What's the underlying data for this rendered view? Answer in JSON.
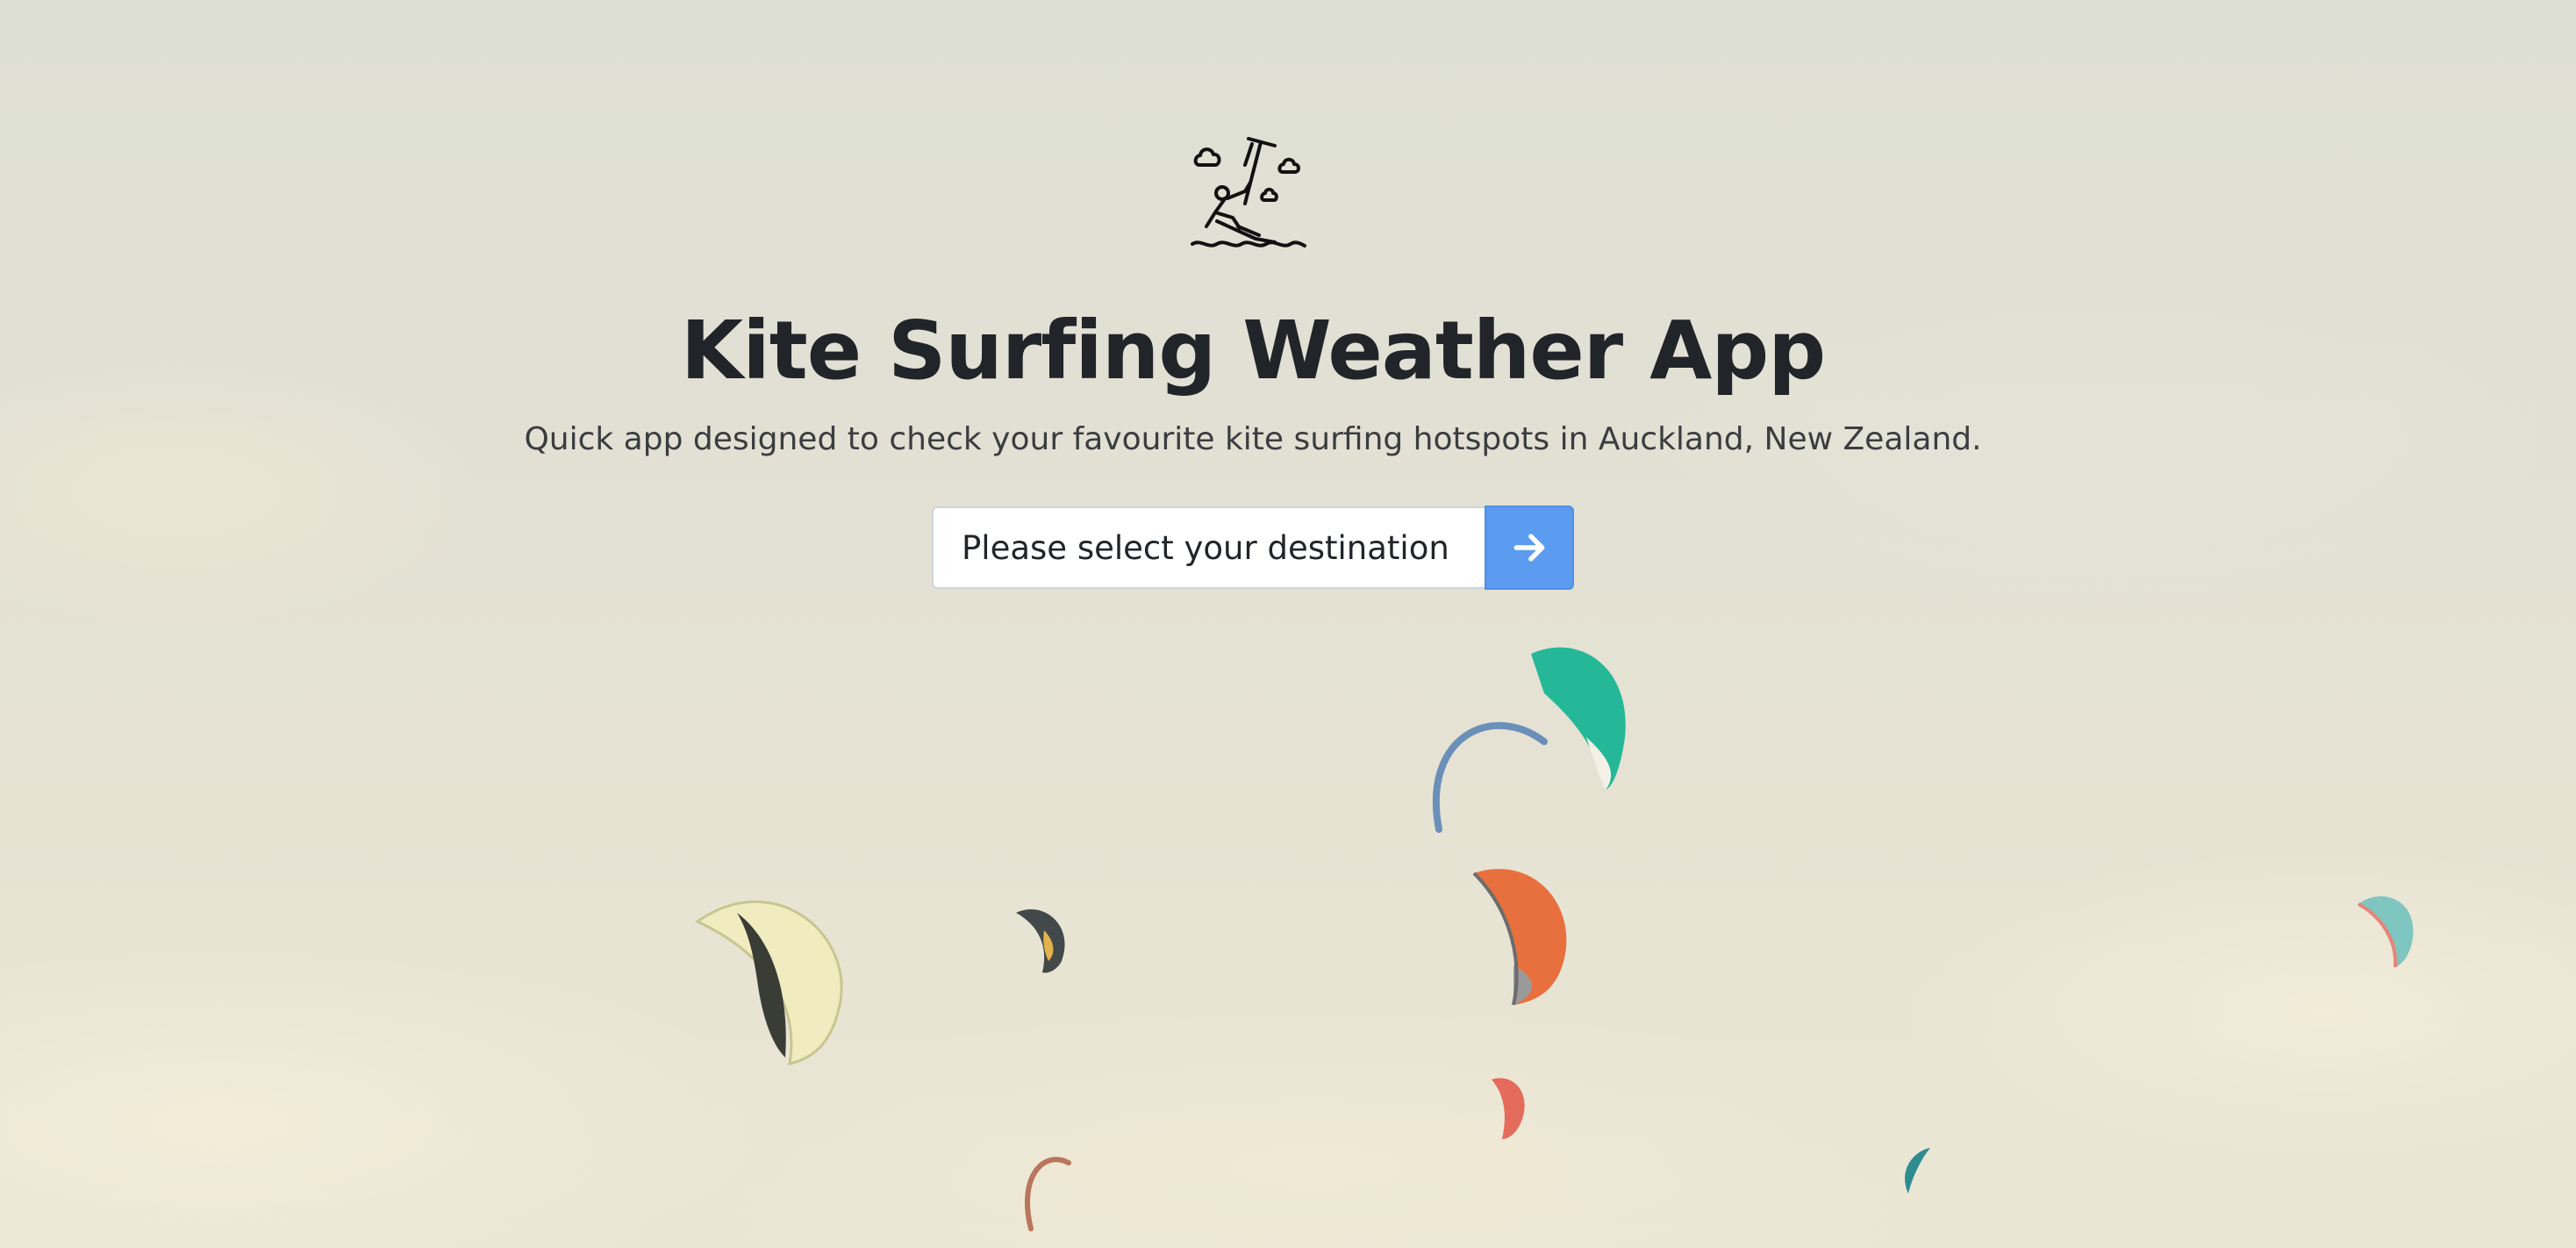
{
  "app": {
    "logo_icon": "kitesurfer-icon",
    "title": "Kite Surfing Weather App",
    "subtitle": "Quick app designed to check your favourite kite surfing hotspots in Auckland, New Zealand."
  },
  "destination_form": {
    "select_label": "Please select your destination",
    "select_icon": "chevron-down-icon",
    "submit_icon": "arrow-right-icon"
  },
  "colors": {
    "button": "#5b9bf0",
    "title": "#212529",
    "background": "#e4e2d6"
  }
}
